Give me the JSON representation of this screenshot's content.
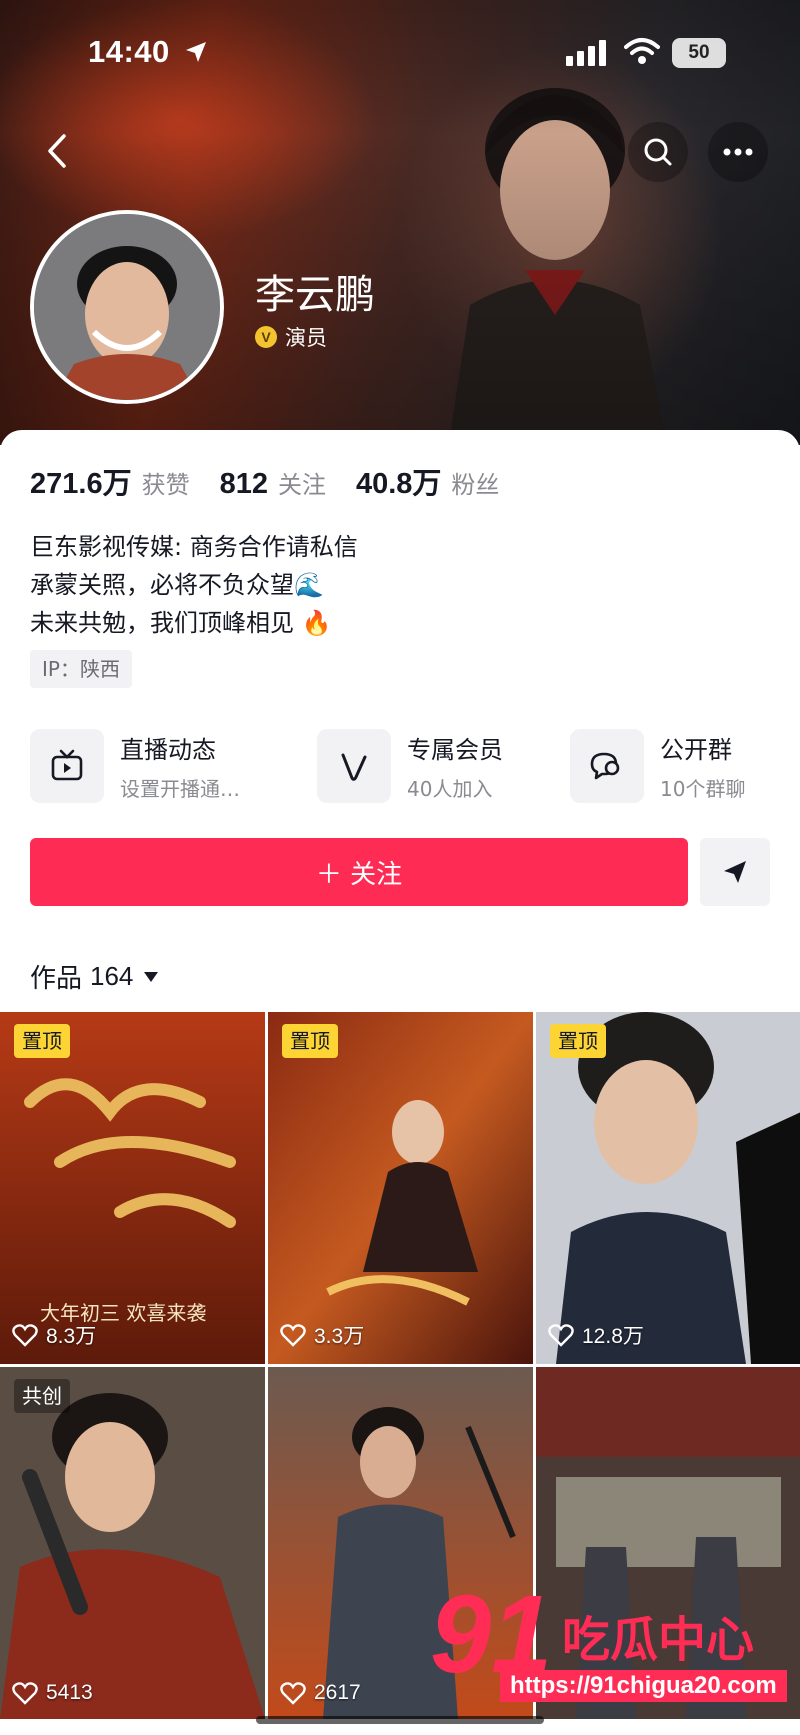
{
  "status_bar": {
    "time": "14:40",
    "battery": "50"
  },
  "profile": {
    "name": "李云鹏",
    "verification": "演员"
  },
  "stats": [
    {
      "value": "271.6万",
      "label": "获赞"
    },
    {
      "value": "812",
      "label": "关注"
    },
    {
      "value": "40.8万",
      "label": "粉丝"
    }
  ],
  "bio": {
    "lines": [
      "巨东影视传媒: 商务合作请私信",
      "承蒙关照，必将不负众望🌊",
      "未来共勉，我们顶峰相见 🔥"
    ],
    "ip": "IP：陕西"
  },
  "features": [
    {
      "title": "直播动态",
      "subtitle": "设置开播通…",
      "icon": "tv-icon"
    },
    {
      "title": "专属会员",
      "subtitle": "40人加入",
      "icon": "v-member-icon"
    },
    {
      "title": "公开群",
      "subtitle": "10个群聊",
      "icon": "chat-group-icon"
    }
  ],
  "actions": {
    "follow": "＋ 关注"
  },
  "works": {
    "label": "作品",
    "count": "164"
  },
  "videos": [
    {
      "badge": "置顶",
      "likes": "8.3万",
      "title": "大年初三 欢喜来袭"
    },
    {
      "badge": "置顶",
      "likes": "3.3万"
    },
    {
      "badge": "置顶",
      "likes": "12.8万"
    },
    {
      "badge": "共创",
      "likes": "5413"
    },
    {
      "badge": "",
      "likes": "2617"
    },
    {
      "badge": "",
      "likes": ""
    }
  ],
  "watermark": {
    "number": "91",
    "text": "吃瓜中心",
    "url": "https://91chigua20.com"
  },
  "colors": {
    "primary": "#fe2c55",
    "pin_badge": "#fcd535"
  }
}
